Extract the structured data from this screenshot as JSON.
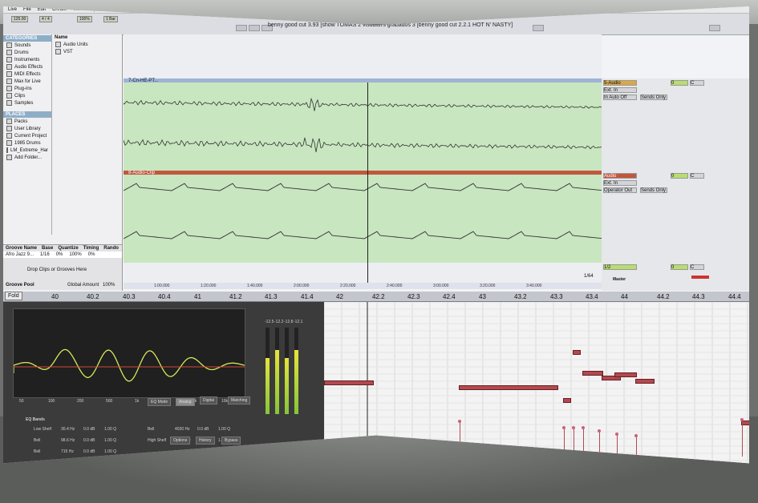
{
  "window": {
    "title": "benny good cut 3.93 [show TOMAS 2 visualizrs grabados 3 [benny good cut 2.2.1 HOT N' NASTY]"
  },
  "menubar": {
    "items": [
      "Live",
      "File",
      "Edit",
      "Create",
      "View",
      "Options",
      "Help"
    ]
  },
  "transport": {
    "tempo": "125.00",
    "time_sig": "4 / 4",
    "zoom": "100%",
    "bar_display": "1 Bar"
  },
  "browser": {
    "categories_header": "CATEGORIES",
    "categories": [
      "Sounds",
      "Drums",
      "Instruments",
      "Audio Effects",
      "MIDI Effects",
      "Max for Live",
      "Plug-ins",
      "Clips",
      "Samples"
    ],
    "places_header": "PLACES",
    "places": [
      "Packs",
      "User Library",
      "Current Project",
      "1985 Drums",
      "LM_Extreme_Har",
      "Add Folder..."
    ],
    "name_header": "Name",
    "name_items": [
      "Audio Units",
      "VST"
    ]
  },
  "groove": {
    "columns": [
      "Groove Name",
      "Base",
      "Quantize",
      "Timing",
      "Rando"
    ],
    "row": [
      "Afro Jazz 9...",
      "1/16",
      "0%",
      "100%",
      "0%"
    ],
    "hint": "Drop Clips or Grooves Here",
    "pool_label": "Groove Pool",
    "global_label": "Global Amount",
    "global_value": "100%"
  },
  "arrangement": {
    "track1_name": "7-Cn-HE-PT...",
    "track2_name": "8-Audio-Clip",
    "time_display": "1/64"
  },
  "mixer": {
    "track1": {
      "name": "5-Audio",
      "input": "Ext. In",
      "io": "In Auto Off",
      "sends": "Sends Only",
      "volume": "0",
      "pan": "C"
    },
    "track2": {
      "name": "Audio",
      "input": "Ext. In",
      "io": "Operator Out",
      "sends": "Sends Only",
      "volume": "0",
      "pan": "C"
    },
    "master": {
      "name": "Master",
      "input": "1/2",
      "volume": "0",
      "pan": "C"
    }
  },
  "timeline_labels": [
    "1:00.000",
    "1:20.000",
    "1:40.000",
    "2:00.000",
    "2:20.000",
    "2:40.000",
    "3:00.000",
    "3:20.000",
    "3:40.000"
  ],
  "ruler": {
    "fold_label": "Fold",
    "marks": [
      "40",
      "40.2",
      "40.3",
      "40.4",
      "41",
      "41.2",
      "41.3",
      "41.4",
      "42",
      "42.2",
      "42.3",
      "42.4",
      "43",
      "43.2",
      "43.3",
      "43.4",
      "44",
      "44.2",
      "44.3",
      "44.4"
    ]
  },
  "eq": {
    "freq_labels": [
      "50",
      "100",
      "200",
      "500",
      "1k",
      "2k",
      "5k",
      "10k"
    ],
    "mode_label": "EQ Mode",
    "mode_value": "Analog",
    "digital_label": "Digital",
    "matching_label": "Matching",
    "bands_label": "EQ Bands",
    "band_rows": [
      {
        "type": "Low Shelf",
        "freq": "30.4 Hz",
        "gain": "0.0 dB",
        "q": "1.00 Q"
      },
      {
        "type": "Bell",
        "freq": "98.6 Hz",
        "gain": "0.0 dB",
        "q": "1.00 Q"
      },
      {
        "type": "Bell",
        "freq": "715 Hz",
        "gain": "0.0 dB",
        "q": "1.00 Q"
      }
    ],
    "band_rows_right": [
      {
        "type": "Bell",
        "freq": "4030 Hz",
        "gain": "0.0 dB",
        "q": "1.00 Q"
      },
      {
        "type": "High Shelf",
        "freq": "12.0 kHz",
        "gain": "0.0 dB",
        "q": "1.00 Q"
      }
    ],
    "bottom_buttons": [
      "Options",
      "History",
      "Bypass"
    ],
    "meter_values": [
      "-12.5",
      "-12.2",
      "-12.8",
      "-12.1"
    ]
  },
  "colors": {
    "clip_green": "#c8e6c0",
    "track_blue": "#9fb3d7",
    "track_red": "#c2563e",
    "note_red": "#b24a50",
    "velocity_pink": "#c9617a",
    "eq_curve": "#d8e85a"
  }
}
